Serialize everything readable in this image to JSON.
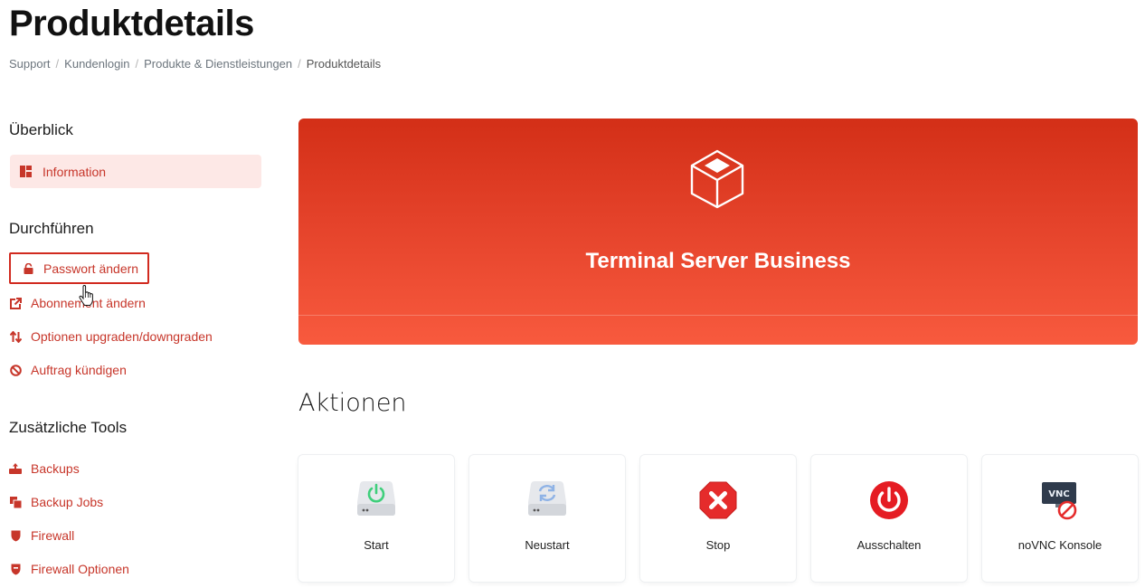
{
  "page": {
    "title": "Produktdetails"
  },
  "breadcrumb": [
    {
      "label": "Support"
    },
    {
      "label": "Kundenlogin"
    },
    {
      "label": "Produkte & Dienstleistungen"
    },
    {
      "label": "Produktdetails"
    }
  ],
  "sidebar": {
    "overview_heading": "Überblick",
    "information": "Information",
    "run_heading": "Durchführen",
    "run_items": [
      {
        "label": "Passwort ändern",
        "icon": "lock-icon"
      },
      {
        "label": "Abonnement ändern",
        "icon": "external-link-icon"
      },
      {
        "label": "Optionen upgraden/downgraden",
        "icon": "sort-arrows-icon"
      },
      {
        "label": "Auftrag kündigen",
        "icon": "ban-icon"
      }
    ],
    "tools_heading": "Zusätzliche Tools",
    "tools_items": [
      {
        "label": "Backups",
        "icon": "backup-icon"
      },
      {
        "label": "Backup Jobs",
        "icon": "copy-icon"
      },
      {
        "label": "Firewall",
        "icon": "shield-icon"
      },
      {
        "label": "Firewall Optionen",
        "icon": "shield-options-icon"
      }
    ]
  },
  "product": {
    "name": "Terminal Server Business",
    "icon": "cube-icon"
  },
  "actions": {
    "title": "Aktionen",
    "items": [
      {
        "label": "Start",
        "icon": "server-power-green-icon"
      },
      {
        "label": "Neustart",
        "icon": "server-restart-icon"
      },
      {
        "label": "Stop",
        "icon": "stop-octagon-icon"
      },
      {
        "label": "Ausschalten",
        "icon": "power-off-icon"
      },
      {
        "label": "noVNC Konsole",
        "icon": "vnc-disabled-icon"
      }
    ]
  },
  "colors": {
    "accent": "#c7362a",
    "hero_top": "#d32f17",
    "hero_bottom": "#f85a3e",
    "active_bg": "#fde8e6"
  }
}
